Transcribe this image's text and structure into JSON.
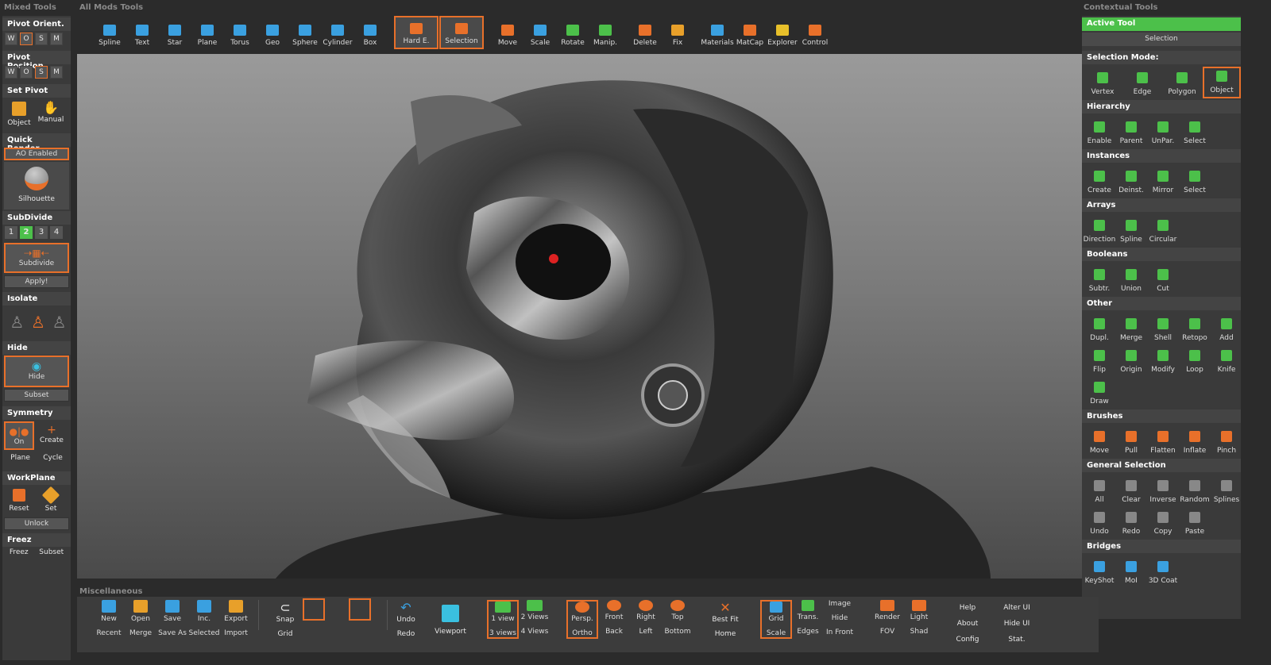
{
  "panels": {
    "left_title": "Mixed Tools",
    "top_title": "All Mods Tools",
    "right_title": "Contextual Tools",
    "bottom_title": "Miscellaneous"
  },
  "left": {
    "pivot_orient": {
      "title": "Pivot Orient.",
      "opts": [
        "W",
        "O",
        "S",
        "M"
      ],
      "selected": "O"
    },
    "pivot_position": {
      "title": "Pivot Position",
      "opts": [
        "W",
        "O",
        "S",
        "M"
      ],
      "selected": "S"
    },
    "set_pivot": {
      "title": "Set Pivot",
      "btns": [
        "Object",
        "Manual"
      ]
    },
    "quick_render": {
      "title": "Quick Render",
      "ao": "AO Enabled",
      "btn": "Silhouette"
    },
    "subdivide": {
      "title": "SubDivide",
      "levels": [
        "1",
        "2",
        "3",
        "4"
      ],
      "selected": "2",
      "btn": "Subdivide",
      "apply": "Apply!"
    },
    "isolate": {
      "title": "Isolate"
    },
    "hide": {
      "title": "Hide",
      "btn": "Hide",
      "sub": "Subset"
    },
    "symmetry": {
      "title": "Symmetry",
      "btns": [
        "On",
        "Create"
      ],
      "subs": [
        "Plane",
        "Cycle"
      ]
    },
    "workplane": {
      "title": "WorkPlane",
      "btns": [
        "Reset",
        "Set"
      ],
      "sub": "Unlock"
    },
    "freez": {
      "title": "Freez",
      "btns": [
        "Freez",
        "Subset"
      ]
    }
  },
  "top_tools": [
    {
      "label": "Spline",
      "icon": "spline-icon",
      "color": "#3aa0e0"
    },
    {
      "label": "Text",
      "icon": "text-icon",
      "color": "#3aa0e0"
    },
    {
      "label": "Star",
      "icon": "star-icon",
      "color": "#3aa0e0"
    },
    {
      "label": "Plane",
      "icon": "plane-icon",
      "color": "#3aa0e0"
    },
    {
      "label": "Torus",
      "icon": "torus-icon",
      "color": "#3aa0e0"
    },
    {
      "label": "Geo",
      "icon": "geo-icon",
      "color": "#3aa0e0"
    },
    {
      "label": "Sphere",
      "icon": "sphere-icon",
      "color": "#3aa0e0"
    },
    {
      "label": "Cylinder",
      "icon": "cylinder-icon",
      "color": "#3aa0e0"
    },
    {
      "label": "Box",
      "icon": "box-icon",
      "color": "#3aa0e0"
    },
    {
      "label": "Hard E.",
      "icon": "hard-edge-icon",
      "color": "#e8702a"
    },
    {
      "label": "Selection",
      "icon": "selection-icon",
      "color": "#e8702a"
    },
    {
      "label": "Move",
      "icon": "move-icon",
      "color": "#e8702a"
    },
    {
      "label": "Scale",
      "icon": "scale-icon",
      "color": "#3aa0e0"
    },
    {
      "label": "Rotate",
      "icon": "rotate-icon",
      "color": "#4cc04a"
    },
    {
      "label": "Manip.",
      "icon": "manip-icon",
      "color": "#4cc04a"
    },
    {
      "label": "Delete",
      "icon": "delete-icon",
      "color": "#e8702a"
    },
    {
      "label": "Fix",
      "icon": "fix-icon",
      "color": "#e8a02a"
    },
    {
      "label": "Materials",
      "icon": "materials-icon",
      "color": "#3aa0e0"
    },
    {
      "label": "MatCap",
      "icon": "matcap-icon",
      "color": "#e8702a"
    },
    {
      "label": "Explorer",
      "icon": "explorer-icon",
      "color": "#e8c02a"
    },
    {
      "label": "Control",
      "icon": "control-icon",
      "color": "#e8702a"
    }
  ],
  "right": {
    "active_tool": "Active Tool",
    "active_value": "Selection",
    "selection_mode": {
      "title": "Selection Mode:",
      "items": [
        "Vertex",
        "Edge",
        "Polygon",
        "Object"
      ],
      "selected": "Object"
    },
    "hierarchy": {
      "title": "Hierarchy",
      "items": [
        "Enable",
        "Parent",
        "UnPar.",
        "Select"
      ]
    },
    "instances": {
      "title": "Instances",
      "items": [
        "Create",
        "Deinst.",
        "Mirror",
        "Select"
      ]
    },
    "arrays": {
      "title": "Arrays",
      "items": [
        "Direction",
        "Spline",
        "Circular"
      ]
    },
    "booleans": {
      "title": "Booleans",
      "items": [
        "Subtr.",
        "Union",
        "Cut"
      ]
    },
    "other": {
      "title": "Other",
      "items": [
        "Dupl.",
        "Merge",
        "Shell",
        "Retopo",
        "Add",
        "Flip",
        "Origin",
        "Modify",
        "Loop",
        "Knife",
        "Draw"
      ]
    },
    "brushes": {
      "title": "Brushes",
      "items": [
        "Move",
        "Pull",
        "Flatten",
        "Inflate",
        "Pinch"
      ]
    },
    "general_selection": {
      "title": "General Selection",
      "items": [
        "All",
        "Clear",
        "Inverse",
        "Random",
        "Splines",
        "Undo",
        "Redo",
        "Copy",
        "Paste"
      ]
    },
    "bridges": {
      "title": "Bridges",
      "items": [
        "KeyShot",
        "MoI",
        "3D Coat"
      ]
    }
  },
  "bottom": {
    "file": {
      "top": [
        "New",
        "Open",
        "Save",
        "Inc.",
        "Export"
      ],
      "bottom": [
        "Recent",
        "Merge",
        "Save As",
        "Selected",
        "Import"
      ]
    },
    "snap": {
      "top": "Snap",
      "bottom": "Grid"
    },
    "undo": {
      "top": "Undo",
      "bottom": "Redo"
    },
    "viewport": "Viewport",
    "views": {
      "top": [
        "1 view",
        "2 Views"
      ],
      "bottom": [
        "3 views",
        "4 Views"
      ]
    },
    "cams": {
      "top": [
        "Persp.",
        "Front",
        "Right",
        "Top"
      ],
      "bottom": [
        "Ortho",
        "Back",
        "Left",
        "Bottom"
      ]
    },
    "fit": {
      "top": "Best Fit",
      "bottom": "Home"
    },
    "display": {
      "top": [
        "Grid",
        "Trans.",
        "Image"
      ],
      "bottom": [
        "Scale",
        "Edges",
        "In Front"
      ],
      "extra": "Hide"
    },
    "render": {
      "top": [
        "Render",
        "Light"
      ],
      "bottom": [
        "FOV",
        "Shad"
      ]
    },
    "help": {
      "top": "Help",
      "mid": "About",
      "bottom": "Config"
    },
    "ui": {
      "top": "Alter UI",
      "mid": "Hide UI",
      "bottom": "Stat."
    }
  }
}
